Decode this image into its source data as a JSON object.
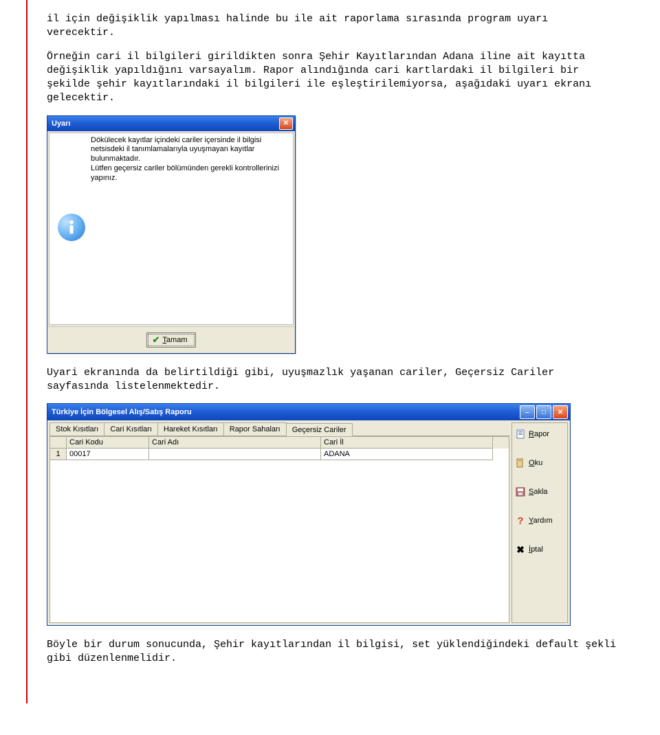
{
  "para1": "il için değişiklik yapılması halinde bu ile ait raporlama sırasında program uyarı verecektir.",
  "para2": "Örneğin cari il bilgileri girildikten sonra Şehir Kayıtlarından Adana iline ait kayıtta değişiklik yapıldığını varsayalım. Rapor alındığında cari kartlardaki il bilgileri bir şekilde şehir kayıtlarındaki il bilgileri ile eşleştirilemiyorsa, aşağıdaki uyarı ekranı gelecektir.",
  "dialog": {
    "title": "Uyarı",
    "text": "Dökülecek kayıtlar içindeki cariler içersinde il bilgisi netsisdeki il tanımlamalarıyla uyuşmayan kayıtlar bulunmaktadır.\nLütfen geçersiz cariler bölümünden gerekli kontrollerinizi yapınız.",
    "ok_letter": "T",
    "ok_rest": "amam"
  },
  "para3": "Uyari ekranında da belirtildiği gibi, uyuşmazlık yaşanan cariler, Geçersiz Cariler sayfasında listelenmektedir.",
  "win": {
    "title": "Türkiye İçin Bölgesel Alış/Satış Raporu",
    "tabs": [
      "Stok Kısıtları",
      "Cari Kısıtları",
      "Hareket Kısıtları",
      "Rapor Sahaları",
      "Geçersiz Cariler"
    ],
    "active_tab": 4,
    "columns": [
      "",
      "Cari Kodu",
      "Cari Adı",
      "Cari İl"
    ],
    "rows": [
      {
        "n": "1",
        "kod": "00017",
        "ad": "",
        "il": "ADANA"
      }
    ],
    "side": {
      "rapor_u": "R",
      "rapor_rest": "apor",
      "oku_u": "O",
      "oku_rest": "ku",
      "sakla_u": "S",
      "sakla_rest": "akla",
      "yardim_u": "Y",
      "yardim_rest": "ardım",
      "iptal_u": "İ",
      "iptal_rest": "ptal"
    }
  },
  "para4": "Böyle bir durum sonucunda, Şehir kayıtlarından il bilgisi, set yüklendiğindeki default şekli gibi düzenlenmelidir."
}
